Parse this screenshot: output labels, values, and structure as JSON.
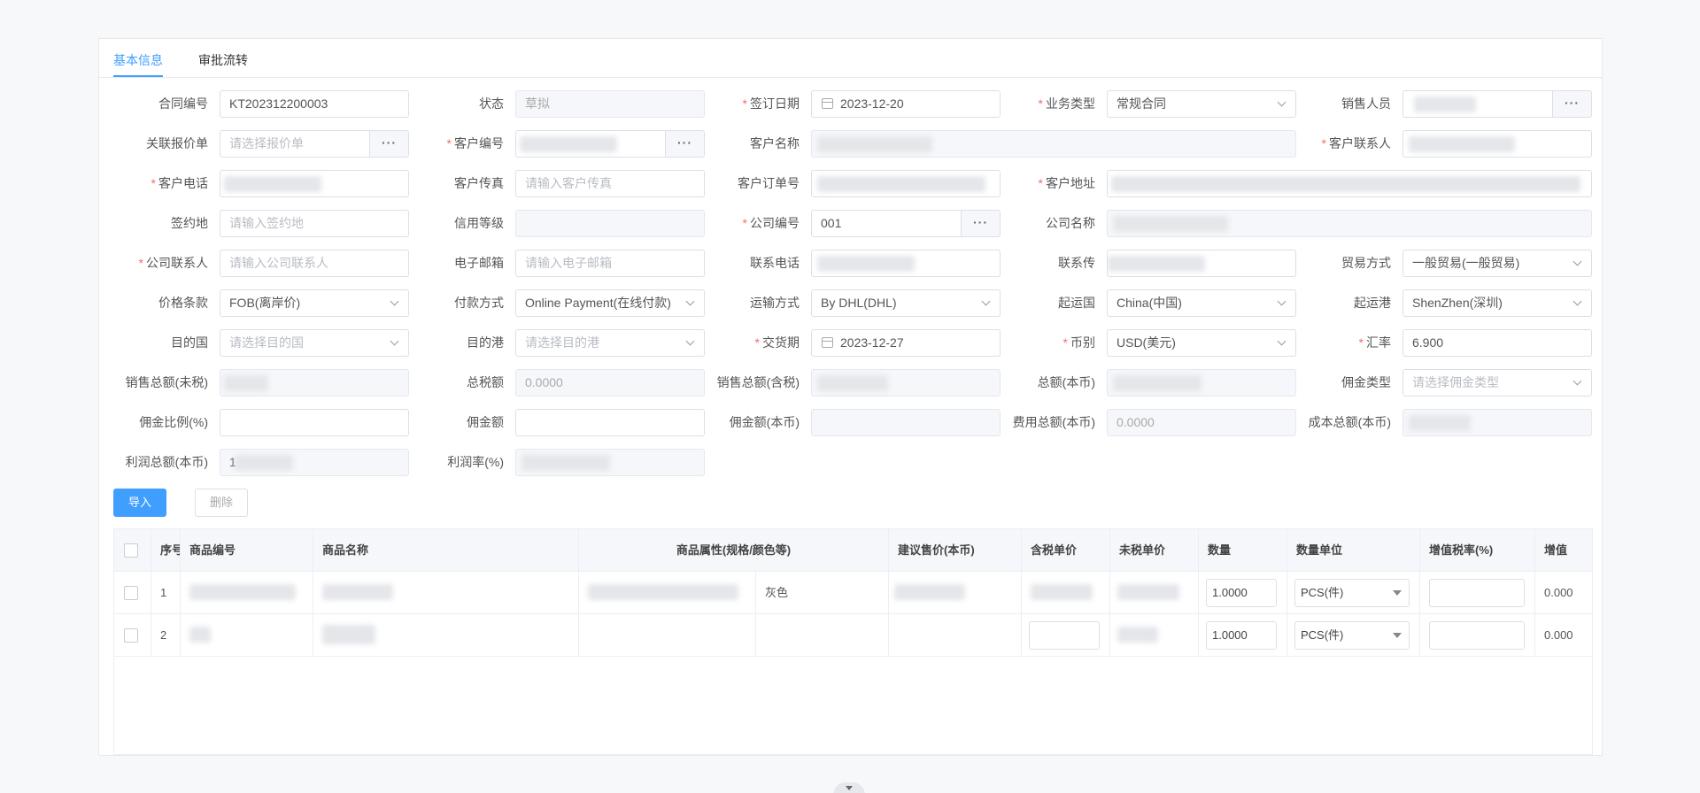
{
  "tabs": [
    "基本信息",
    "审批流转"
  ],
  "form": {
    "contract_no": {
      "label": "合同编号",
      "value": "KT202312200003"
    },
    "status": {
      "label": "状态",
      "value": "草拟"
    },
    "sign_date": {
      "label": "签订日期",
      "value": "2023-12-20"
    },
    "biz_type": {
      "label": "业务类型",
      "value": "常规合同"
    },
    "salesperson": {
      "label": "销售人员"
    },
    "quote": {
      "label": "关联报价单",
      "placeholder": "请选择报价单"
    },
    "customer_no": {
      "label": "客户编号"
    },
    "customer_name": {
      "label": "客户名称"
    },
    "customer_contact": {
      "label": "客户联系人"
    },
    "customer_phone": {
      "label": "客户电话"
    },
    "customer_fax": {
      "label": "客户传真",
      "placeholder": "请输入客户传真"
    },
    "customer_order": {
      "label": "客户订单号"
    },
    "customer_address": {
      "label": "客户地址"
    },
    "sign_place": {
      "label": "签约地",
      "placeholder": "请输入签约地"
    },
    "credit_level": {
      "label": "信用等级"
    },
    "company_no": {
      "label": "公司编号",
      "value": "001"
    },
    "company_name": {
      "label": "公司名称"
    },
    "company_contact": {
      "label": "公司联系人",
      "placeholder": "请输入公司联系人"
    },
    "email": {
      "label": "电子邮箱",
      "placeholder": "请输入电子邮箱"
    },
    "phone": {
      "label": "联系电话"
    },
    "contact_fax": {
      "label": "联系传"
    },
    "trade_mode": {
      "label": "贸易方式",
      "value": "一般贸易(一般贸易)"
    },
    "price_term": {
      "label": "价格条款",
      "value": "FOB(离岸价)"
    },
    "payment": {
      "label": "付款方式",
      "value": "Online Payment(在线付款)"
    },
    "shipping": {
      "label": "运输方式",
      "value": "By DHL(DHL)"
    },
    "origin_country": {
      "label": "起运国",
      "value": "China(中国)"
    },
    "origin_port": {
      "label": "起运港",
      "value": "ShenZhen(深圳)"
    },
    "dest_country": {
      "label": "目的国",
      "placeholder": "请选择目的国"
    },
    "dest_port": {
      "label": "目的港",
      "placeholder": "请选择目的港"
    },
    "delivery_date": {
      "label": "交货期",
      "value": "2023-12-27"
    },
    "currency": {
      "label": "币别",
      "value": "USD(美元)"
    },
    "rate": {
      "label": "汇率",
      "value": "6.900"
    },
    "sales_total_ex": {
      "label": "销售总额(未税)"
    },
    "tax_total": {
      "label": "总税额",
      "value": "0.0000"
    },
    "sales_total_in": {
      "label": "销售总额(含税)"
    },
    "total_local": {
      "label": "总额(本币)"
    },
    "commission_type": {
      "label": "佣金类型",
      "placeholder": "请选择佣金类型"
    },
    "commission_ratio": {
      "label": "佣金比例(%)"
    },
    "commission_amt": {
      "label": "佣金额"
    },
    "commission_local": {
      "label": "佣金额(本币)"
    },
    "expense_local": {
      "label": "费用总额(本币)",
      "value": "0.0000"
    },
    "cost_local": {
      "label": "成本总额(本币)"
    },
    "profit_local": {
      "label": "利润总额(本币)",
      "value": "1"
    },
    "profit_rate": {
      "label": "利润率(%)"
    }
  },
  "buttons": {
    "import": "导入",
    "delete": "删除"
  },
  "table": {
    "headers": [
      "序号",
      "商品编号",
      "商品名称",
      "商品属性(规格/颜色等)",
      "建议售价(本币)",
      "含税单价",
      "未税单价",
      "数量",
      "数量单位",
      "增值税率(%)",
      "增值"
    ],
    "rows": [
      {
        "seq": "1",
        "color": "灰色",
        "qty": "1.0000",
        "unit": "PCS(件)",
        "vat": "0.000"
      },
      {
        "seq": "2",
        "color": "",
        "qty": "1.0000",
        "unit": "PCS(件)",
        "vat": "0.000"
      }
    ]
  }
}
